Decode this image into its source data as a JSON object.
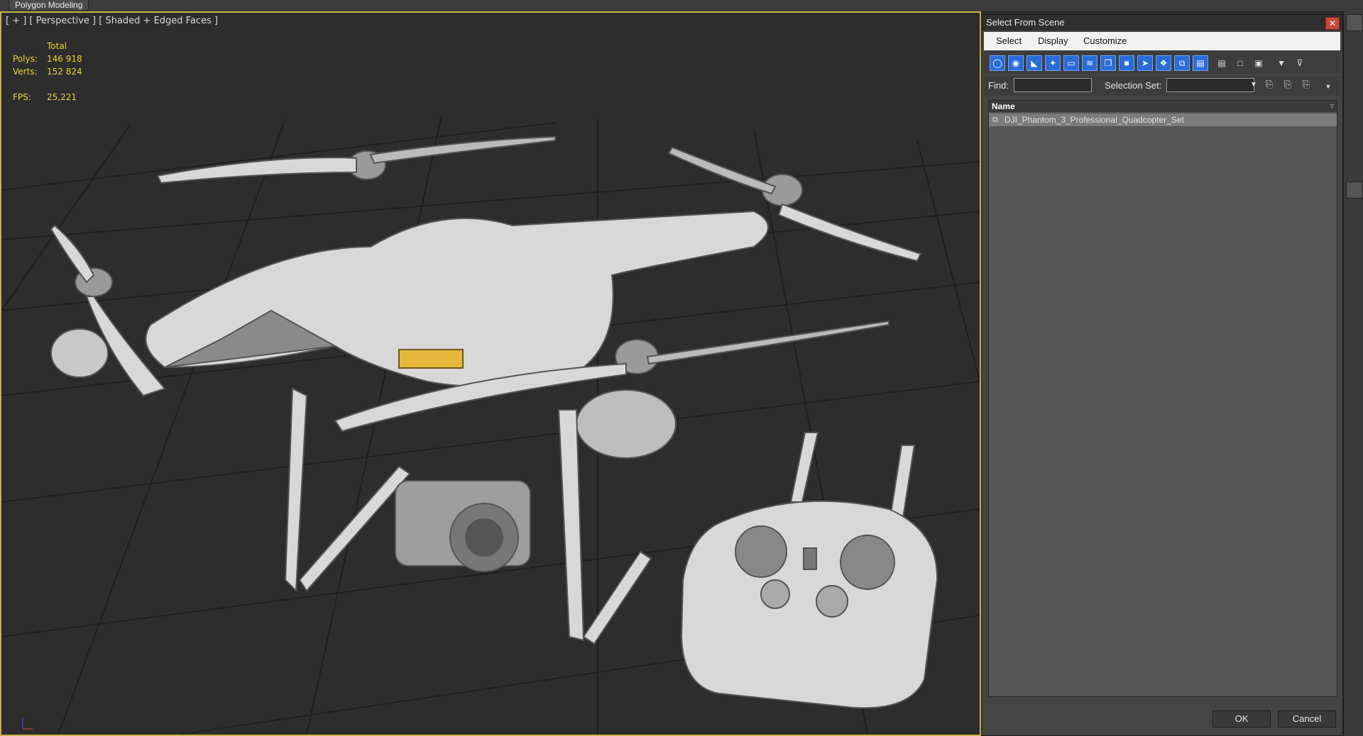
{
  "ribbon": {
    "tab_label": "Polygon Modeling"
  },
  "viewport": {
    "label": "[ + ] [ Perspective ] [ Shaded + Edged Faces ]",
    "stats": {
      "total_label": "Total",
      "polys_label": "Polys:",
      "polys_value": "146 918",
      "verts_label": "Verts:",
      "verts_value": "152 824",
      "fps_label": "FPS:",
      "fps_value": "25,221"
    }
  },
  "dialog": {
    "title": "Select From Scene",
    "close_glyph": "✕",
    "menu": [
      "Select",
      "Display",
      "Customize"
    ],
    "toolbar_icons": [
      "all-objects-icon",
      "geometry-icon",
      "shapes-icon",
      "lights-icon",
      "cameras-icon",
      "helpers-icon",
      "space-warps-icon",
      "groups-icon",
      "xrefs-icon",
      "bones-icon",
      "containers-icon",
      "frozen-icon",
      "select-all-icon",
      "select-none-icon",
      "select-invert-icon",
      "filter-icon",
      "filter-options-icon"
    ],
    "find_label": "Find:",
    "find_value": "",
    "selection_set_label": "Selection Set:",
    "selection_set_value": "",
    "list_header": "Name",
    "rows": [
      "DJI_Phantom_3_Professional_Quadcopter_Set"
    ],
    "ok_label": "OK",
    "cancel_label": "Cancel"
  },
  "colors": {
    "viewport_bg": "#2d2d2d",
    "viewport_border": "#c9b04a",
    "stats_text": "#f0d23a",
    "toolbar_accent": "#2a6bd6"
  }
}
